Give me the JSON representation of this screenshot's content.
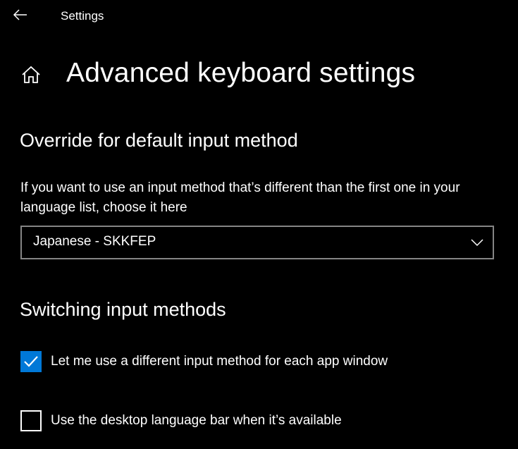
{
  "window": {
    "title": "Settings",
    "back_icon": "back-arrow-icon"
  },
  "header": {
    "home_icon": "home-icon",
    "title": "Advanced keyboard settings"
  },
  "override_section": {
    "heading": "Override for default input method",
    "description": "If you want to use an input method that’s different than the first one in your language list, choose it here",
    "dropdown": {
      "selected": "Japanese - SKKFEP",
      "icon": "chevron-down-icon"
    }
  },
  "switching_section": {
    "heading": "Switching input methods",
    "options": [
      {
        "label": "Let me use a different input method for each app window",
        "checked": true
      },
      {
        "label": "Use the desktop language bar when it’s available",
        "checked": false
      }
    ]
  },
  "colors": {
    "accent": "#0078d7",
    "background": "#000000",
    "text": "#ffffff",
    "dropdown_border": "#858585"
  }
}
